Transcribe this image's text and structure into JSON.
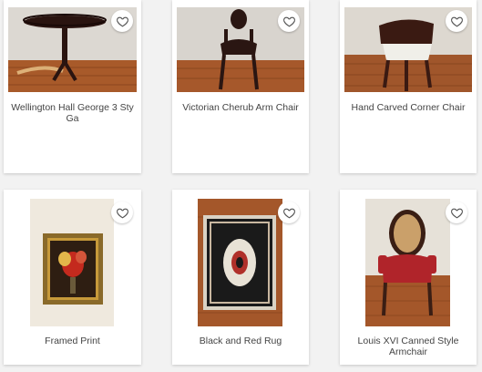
{
  "grid": {
    "items": [
      {
        "title": "Wellington Hall George 3 Sty Ga",
        "favorite_icon": "heart-outline-icon"
      },
      {
        "title": "Victorian Cherub Arm Chair",
        "favorite_icon": "heart-outline-icon"
      },
      {
        "title": "Hand Carved Corner Chair",
        "favorite_icon": "heart-outline-icon"
      },
      {
        "title": "Framed Print",
        "favorite_icon": "heart-outline-icon"
      },
      {
        "title": "Black and Red Rug",
        "favorite_icon": "heart-outline-icon"
      },
      {
        "title": "Louis XVI Canned Style Armchair",
        "favorite_icon": "heart-outline-icon"
      }
    ]
  },
  "colors": {
    "page_bg": "#f2f2f2",
    "card_bg": "#ffffff",
    "title_text": "#444444",
    "heart_stroke": "#555555"
  }
}
